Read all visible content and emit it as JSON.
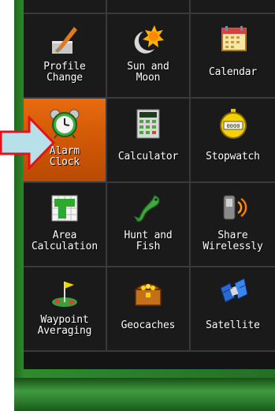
{
  "menu": {
    "tiles": [
      {
        "label": "Profile\nChange",
        "icon": "paintbrush-icon"
      },
      {
        "label": "Sun and\nMoon",
        "icon": "sun-moon-icon"
      },
      {
        "label": "Calendar",
        "icon": "calendar-icon"
      },
      {
        "label": "Alarm\nClock",
        "icon": "alarm-clock-icon",
        "selected": true
      },
      {
        "label": "Calculator",
        "icon": "calculator-icon"
      },
      {
        "label": "Stopwatch",
        "icon": "stopwatch-icon"
      },
      {
        "label": "Area\nCalculation",
        "icon": "area-calculation-icon"
      },
      {
        "label": "Hunt and\nFish",
        "icon": "fish-icon"
      },
      {
        "label": "Share\nWirelessly",
        "icon": "share-wirelessly-icon"
      },
      {
        "label": "Waypoint\nAveraging",
        "icon": "waypoint-flag-icon"
      },
      {
        "label": "Geocaches",
        "icon": "treasure-chest-icon"
      },
      {
        "label": "Satellite",
        "icon": "satellite-icon"
      }
    ]
  },
  "colors": {
    "selected_tile": "#d25a06",
    "tile_background": "#1a1a1a",
    "device_green": "#2f8a2f",
    "pointer_arrow_fill": "#b8e0e8",
    "pointer_arrow_outline": "#e8101a"
  },
  "annotation": {
    "icon": "pointer-arrow-icon"
  }
}
